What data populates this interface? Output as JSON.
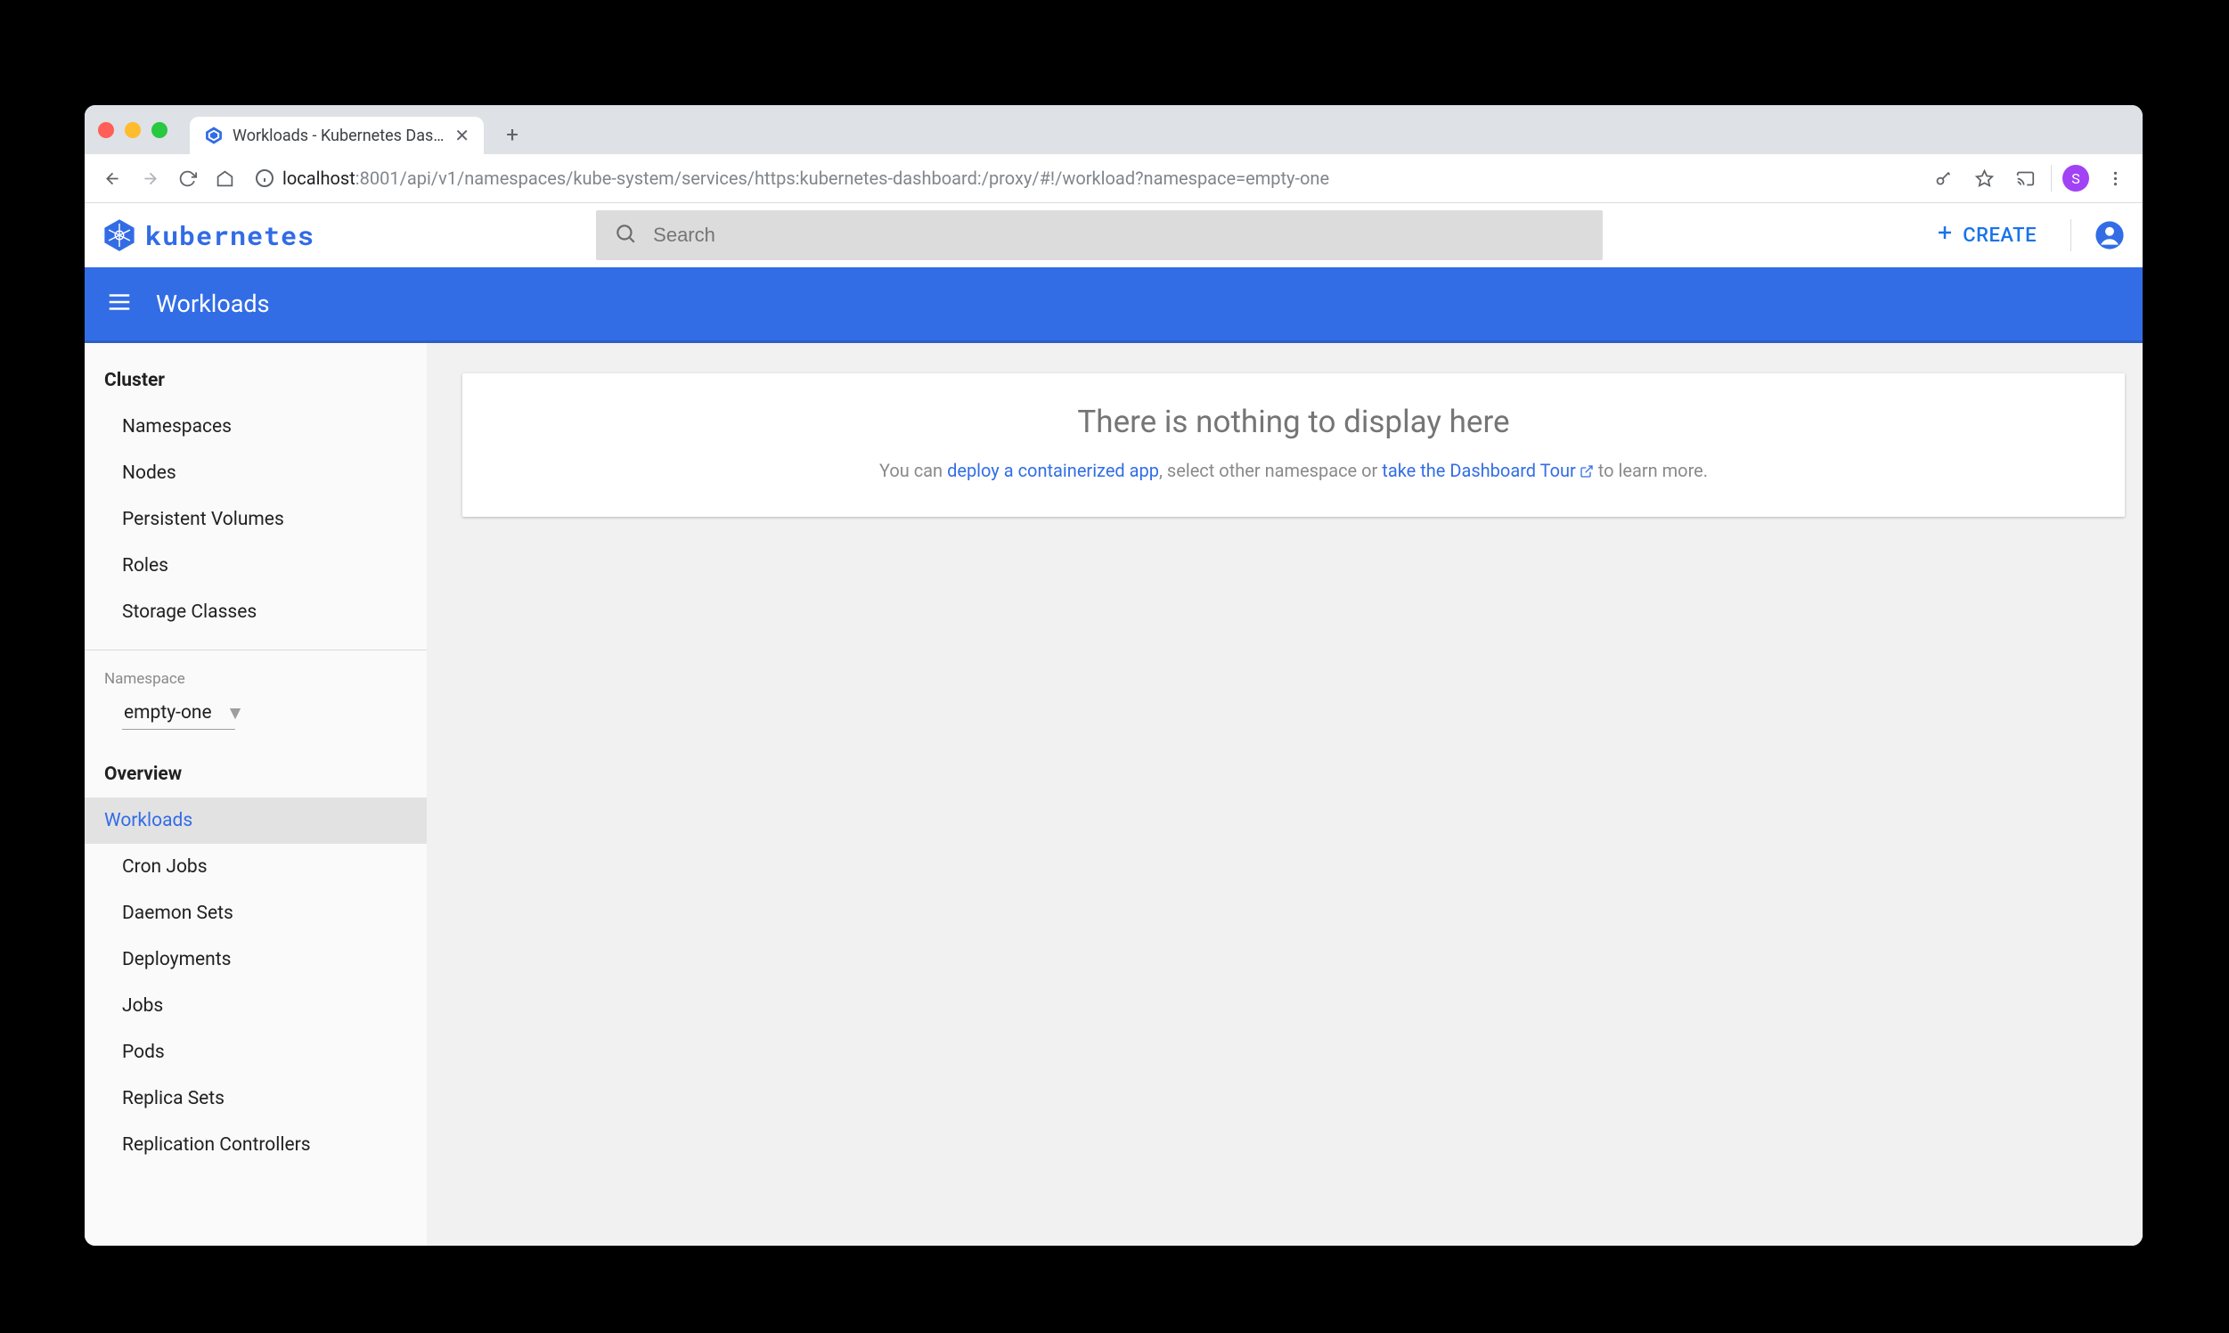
{
  "browser": {
    "tab_title": "Workloads - Kubernetes Dashb",
    "url_host": "localhost",
    "url_port_path": ":8001/api/v1/namespaces/kube-system/services/https:kubernetes-dashboard:/proxy/#!/workload?namespace=empty-one",
    "avatar_letter": "S"
  },
  "header": {
    "brand": "kubernetes",
    "search_placeholder": "Search",
    "create_label": "CREATE"
  },
  "subheader": {
    "title": "Workloads"
  },
  "sidebar": {
    "cluster_header": "Cluster",
    "cluster_items": [
      {
        "label": "Namespaces"
      },
      {
        "label": "Nodes"
      },
      {
        "label": "Persistent Volumes"
      },
      {
        "label": "Roles"
      },
      {
        "label": "Storage Classes"
      }
    ],
    "namespace_label": "Namespace",
    "namespace_selected": "empty-one",
    "overview_header": "Overview",
    "workloads_label": "Workloads",
    "workloads_items": [
      {
        "label": "Cron Jobs"
      },
      {
        "label": "Daemon Sets"
      },
      {
        "label": "Deployments"
      },
      {
        "label": "Jobs"
      },
      {
        "label": "Pods"
      },
      {
        "label": "Replica Sets"
      },
      {
        "label": "Replication Controllers"
      }
    ]
  },
  "main": {
    "empty_title": "There is nothing to display here",
    "empty_prefix": "You can ",
    "empty_link1": "deploy a containerized app",
    "empty_mid": ", select other namespace or ",
    "empty_link2": "take the Dashboard Tour",
    "empty_suffix": " to learn more."
  }
}
